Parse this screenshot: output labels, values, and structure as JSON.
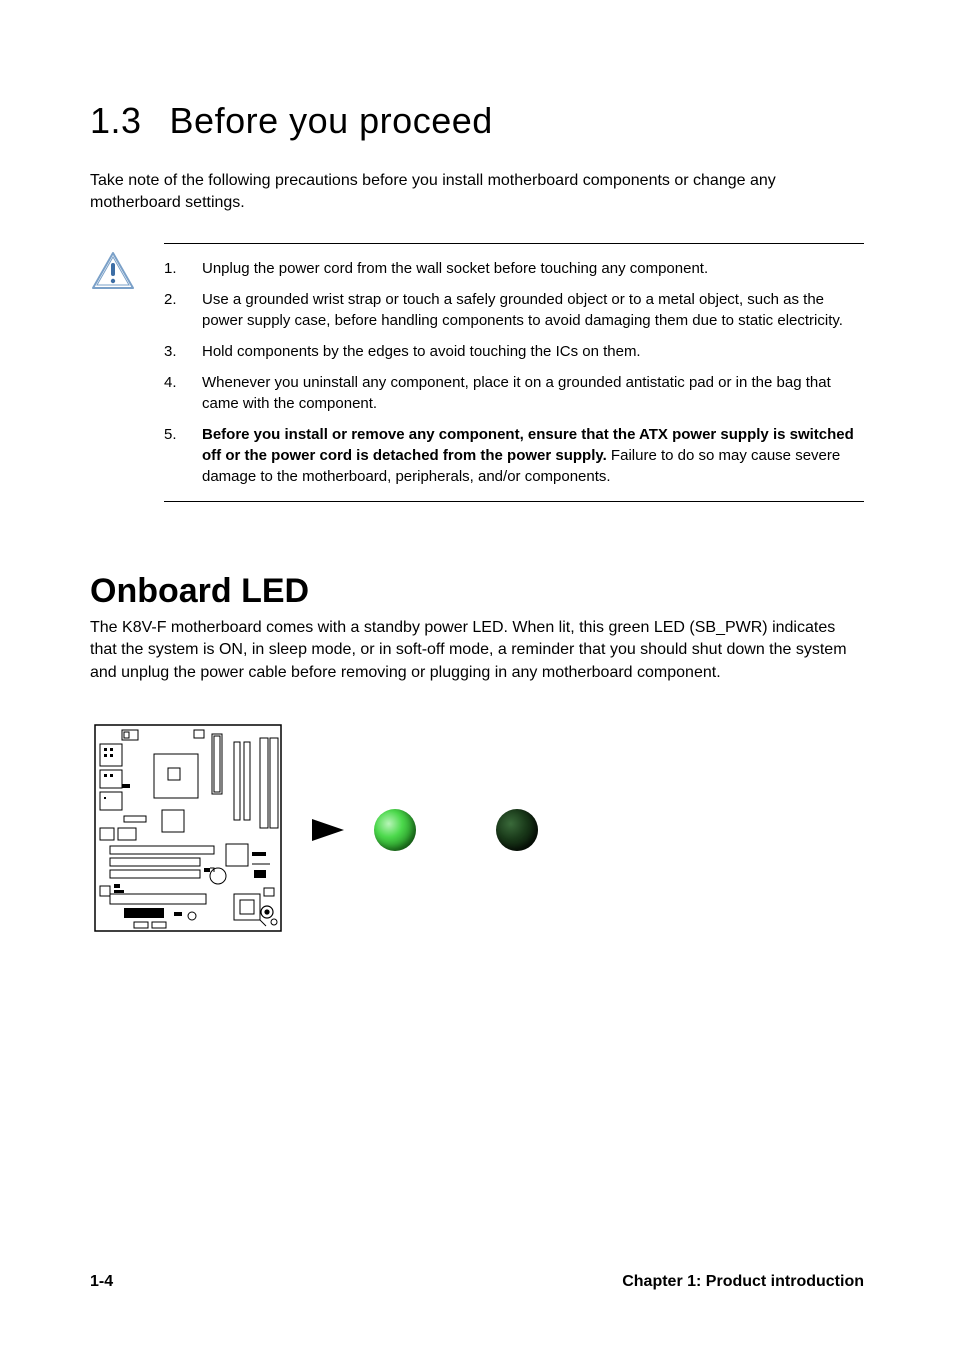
{
  "section": {
    "number": "1.3",
    "title": "Before you proceed",
    "intro": "Take note of the following precautions before you install motherboard components or change any motherboard settings."
  },
  "caution": {
    "items": [
      "Unplug the power cord from the wall socket before touching any component.",
      "Use a grounded wrist strap or touch  a safely grounded object or to a metal object, such as the power supply case, before handling components to avoid damaging them due to static electricity.",
      "Hold components by the edges to avoid touching the ICs on them.",
      "Whenever you uninstall any component, place it on a grounded antistatic pad or in the bag that came with the component.",
      ""
    ],
    "item5_bold": "Before you install or remove any component, ensure that the ATX power supply is switched off or the power cord is detached from the power supply.",
    "item5_rest": " Failure to do so may cause severe damage to the motherboard, peripherals, and/or components."
  },
  "onboard": {
    "heading": "Onboard LED",
    "text": "The K8V-F motherboard comes with a standby power LED. When lit, this green LED (SB_PWR) indicates that the system is ON, in sleep mode, or in soft-off mode, a reminder that you should shut down the system and unplug the power cable before removing or plugging in any motherboard component."
  },
  "footer": {
    "page": "1-4",
    "chapter": "Chapter 1: Product introduction"
  }
}
